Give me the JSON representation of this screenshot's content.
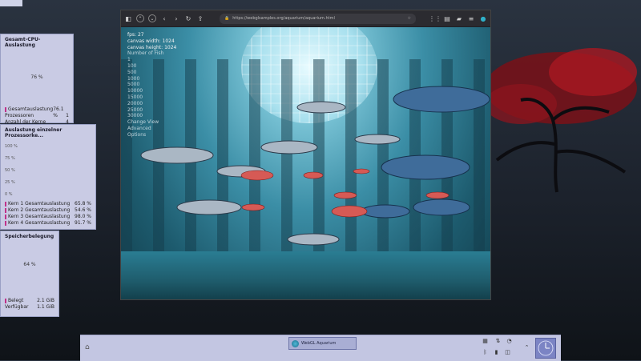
{
  "cpu_widget": {
    "title": "Gesamt-CPU-Auslastung",
    "value": "76 %",
    "rows": [
      {
        "label": "Gesamtauslastung",
        "value": "76.1 %",
        "color": "#c0338a"
      },
      {
        "label": "Prozessoren",
        "value": "1",
        "color": ""
      },
      {
        "label": "Anzahl der Kerne",
        "value": "4",
        "color": ""
      }
    ]
  },
  "cores_widget": {
    "title": "Auslastung einzelner Prozessorke...",
    "axis": [
      "100 %",
      "75 %",
      "50 %",
      "25 %",
      "0 %"
    ],
    "rows": [
      {
        "label": "Kern 1 Gesamtauslastung",
        "value": "65.8 %",
        "color": "#c0338a"
      },
      {
        "label": "Kern 2 Gesamtauslastung",
        "value": "54.6 %",
        "color": "#c0338a"
      },
      {
        "label": "Kern 3 Gesamtauslastung",
        "value": "98.0 %",
        "color": "#c0338a"
      },
      {
        "label": "Kern 4 Gesamtauslastung",
        "value": "91.7 %",
        "color": "#c0338a"
      }
    ]
  },
  "mem_widget": {
    "title": "Speicherbelegung",
    "value": "64 %",
    "rows": [
      {
        "label": "Belegt",
        "value": "2.1 GiB",
        "color": "#c0338a"
      },
      {
        "label": "Verfügbar",
        "value": "1.1 GiB",
        "color": ""
      }
    ]
  },
  "browser": {
    "url": "https://webglsamples.org/aquarium/aquarium.html",
    "toolbar_icons": [
      "firefox-view-icon",
      "account-icon",
      "tabs-dropdown-icon",
      "back-icon",
      "forward-icon",
      "reload-icon",
      "share-icon"
    ],
    "hud": {
      "fps": "fps: 27",
      "width": "canvas width: 1024",
      "height": "canvas height: 1024",
      "num_fish_label": "Number of Fish",
      "options": [
        "1",
        "100",
        "500",
        "1000",
        "5000",
        "10000",
        "15000",
        "20000",
        "25000",
        "30000"
      ],
      "extra": [
        "Change View",
        "Advanced",
        "Options"
      ]
    }
  },
  "taskbar": {
    "task_label": "WebGL Aquarium",
    "clock_label": "clock"
  }
}
